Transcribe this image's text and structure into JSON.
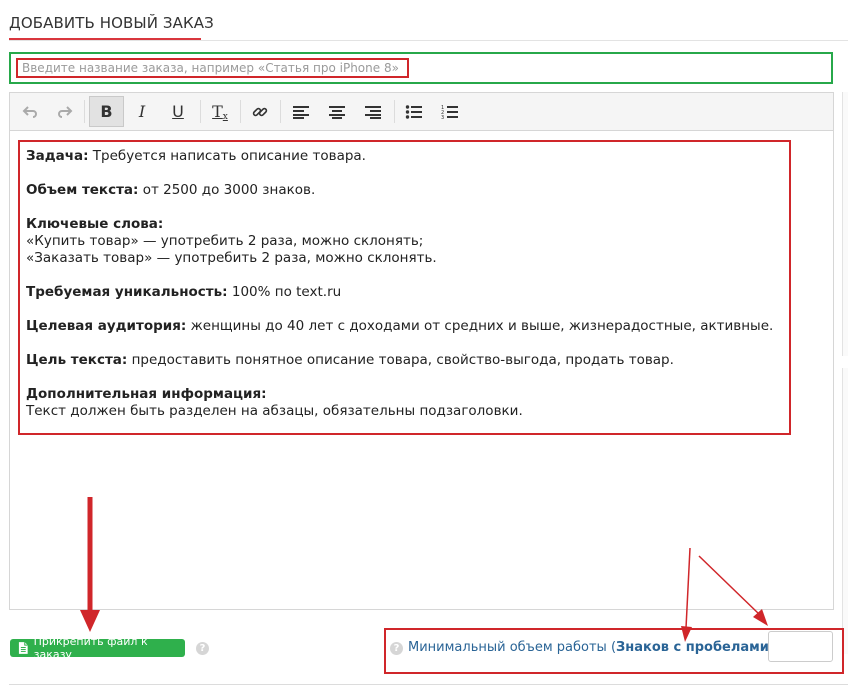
{
  "header": {
    "title": "ДОБАВИТЬ НОВЫЙ ЗАКАЗ"
  },
  "order_title": {
    "value": "",
    "placeholder": "Введите название заказа, например «Статья про iPhone 8»"
  },
  "toolbar": {
    "undo_icon": "undo-icon",
    "redo_icon": "redo-icon",
    "bold_label": "B",
    "italic_label": "I",
    "underline_label": "U",
    "clear_format_label": "T",
    "link_icon": "link-icon",
    "align_left_icon": "align-left-icon",
    "align_center_icon": "align-center-icon",
    "align_right_icon": "align-right-icon",
    "bullet_list_icon": "bullet-list-icon",
    "numbered_list_icon": "numbered-list-icon"
  },
  "content": {
    "task_label": "Задача:",
    "task_text": " Требуется написать описание товара.",
    "volume_label": "Объем текста:",
    "volume_text": " от 2500 до 3000 знаков.",
    "keywords_label": "Ключевые слова:",
    "keyword_1": "«Купить товар» — употребить 2 раза, можно склонять;",
    "keyword_2": "«Заказать товар» — употребить 2 раза, можно склонять.",
    "uniqueness_label": "Требуемая уникальность:",
    "uniqueness_text": " 100% по text.ru",
    "audience_label": "Целевая аудитория:",
    "audience_text": " женщины до 40 лет с доходами от средних и выше, жизнерадостные, активные.",
    "goal_label": "Цель текста:",
    "goal_text": " предоставить понятное описание товара, свойство-выгода, продать товар.",
    "extra_label": "Дополнительная информация:",
    "extra_text": "Текст должен быть разделен на абзацы, обязательны подзаголовки."
  },
  "attach": {
    "label": "Прикрепить файл к заказу"
  },
  "min_volume": {
    "label_prefix": "Минимальный объем работы (",
    "label_bold": "Знаков с пробелами",
    "label_suffix": "):",
    "value": ""
  },
  "colors": {
    "accent_red": "#d0262a",
    "green": "#27a84a",
    "button_green": "#2fb04c",
    "link_blue": "#2a6496"
  }
}
